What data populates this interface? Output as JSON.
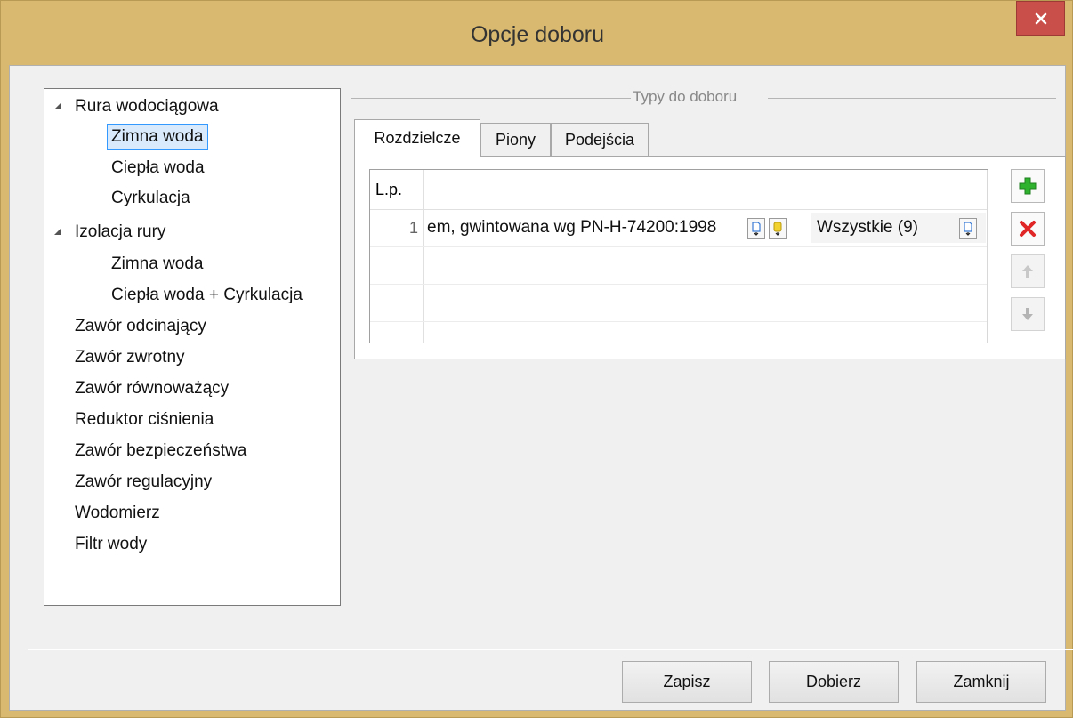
{
  "window": {
    "title": "Opcje doboru",
    "colors": {
      "frame": "#d9b96f",
      "close": "#c9504a",
      "selection": "#3399ff"
    }
  },
  "tree": {
    "items": [
      {
        "label": "Rura wodociągowa",
        "expanded": true,
        "level": 0
      },
      {
        "label": "Zimna woda",
        "level": 1,
        "selected": true
      },
      {
        "label": "Ciepła woda",
        "level": 1
      },
      {
        "label": "Cyrkulacja",
        "level": 1
      },
      {
        "label": "Izolacja rury",
        "expanded": true,
        "level": 0
      },
      {
        "label": "Zimna woda",
        "level": 1
      },
      {
        "label": "Ciepła woda + Cyrkulacja",
        "level": 1
      },
      {
        "label": "Zawór odcinający",
        "level": 0
      },
      {
        "label": "Zawór zwrotny",
        "level": 0
      },
      {
        "label": "Zawór równoważący",
        "level": 0
      },
      {
        "label": "Reduktor ciśnienia",
        "level": 0
      },
      {
        "label": "Zawór bezpieczeństwa",
        "level": 0
      },
      {
        "label": "Zawór regulacyjny",
        "level": 0
      },
      {
        "label": "Wodomierz",
        "level": 0
      },
      {
        "label": "Filtr wody",
        "level": 0
      }
    ]
  },
  "group": {
    "title": "Typy do doboru"
  },
  "tabs": [
    {
      "label": "Rozdzielcze",
      "active": true
    },
    {
      "label": "Piony"
    },
    {
      "label": "Podejścia"
    }
  ],
  "grid": {
    "lp_header": "L.p.",
    "rows": [
      {
        "num": "1",
        "type": "em, gwintowana wg PN-H-74200:1998",
        "filter": "Wszystkie (9)"
      }
    ]
  },
  "side_buttons": {
    "add": "plus-icon",
    "delete": "x-icon",
    "up": "arrow-up-icon",
    "down": "arrow-down-icon"
  },
  "buttons": {
    "save": "Zapisz",
    "select": "Dobierz",
    "close": "Zamknij"
  }
}
